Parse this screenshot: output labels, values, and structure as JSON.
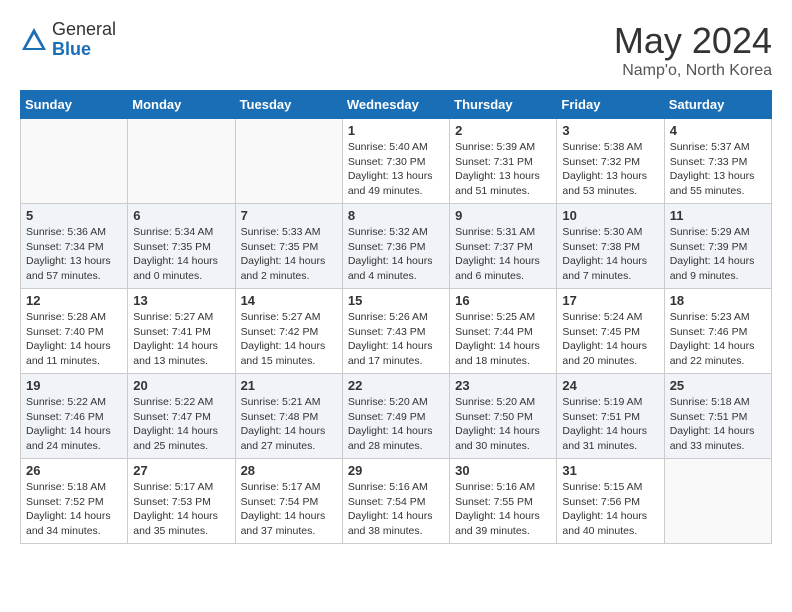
{
  "header": {
    "logo_general": "General",
    "logo_blue": "Blue",
    "month_title": "May 2024",
    "location": "Namp'o, North Korea"
  },
  "days_of_week": [
    "Sunday",
    "Monday",
    "Tuesday",
    "Wednesday",
    "Thursday",
    "Friday",
    "Saturday"
  ],
  "weeks": [
    {
      "days": [
        {
          "number": "",
          "info": ""
        },
        {
          "number": "",
          "info": ""
        },
        {
          "number": "",
          "info": ""
        },
        {
          "number": "1",
          "info": "Sunrise: 5:40 AM\nSunset: 7:30 PM\nDaylight: 13 hours\nand 49 minutes."
        },
        {
          "number": "2",
          "info": "Sunrise: 5:39 AM\nSunset: 7:31 PM\nDaylight: 13 hours\nand 51 minutes."
        },
        {
          "number": "3",
          "info": "Sunrise: 5:38 AM\nSunset: 7:32 PM\nDaylight: 13 hours\nand 53 minutes."
        },
        {
          "number": "4",
          "info": "Sunrise: 5:37 AM\nSunset: 7:33 PM\nDaylight: 13 hours\nand 55 minutes."
        }
      ]
    },
    {
      "days": [
        {
          "number": "5",
          "info": "Sunrise: 5:36 AM\nSunset: 7:34 PM\nDaylight: 13 hours\nand 57 minutes."
        },
        {
          "number": "6",
          "info": "Sunrise: 5:34 AM\nSunset: 7:35 PM\nDaylight: 14 hours\nand 0 minutes."
        },
        {
          "number": "7",
          "info": "Sunrise: 5:33 AM\nSunset: 7:35 PM\nDaylight: 14 hours\nand 2 minutes."
        },
        {
          "number": "8",
          "info": "Sunrise: 5:32 AM\nSunset: 7:36 PM\nDaylight: 14 hours\nand 4 minutes."
        },
        {
          "number": "9",
          "info": "Sunrise: 5:31 AM\nSunset: 7:37 PM\nDaylight: 14 hours\nand 6 minutes."
        },
        {
          "number": "10",
          "info": "Sunrise: 5:30 AM\nSunset: 7:38 PM\nDaylight: 14 hours\nand 7 minutes."
        },
        {
          "number": "11",
          "info": "Sunrise: 5:29 AM\nSunset: 7:39 PM\nDaylight: 14 hours\nand 9 minutes."
        }
      ]
    },
    {
      "days": [
        {
          "number": "12",
          "info": "Sunrise: 5:28 AM\nSunset: 7:40 PM\nDaylight: 14 hours\nand 11 minutes."
        },
        {
          "number": "13",
          "info": "Sunrise: 5:27 AM\nSunset: 7:41 PM\nDaylight: 14 hours\nand 13 minutes."
        },
        {
          "number": "14",
          "info": "Sunrise: 5:27 AM\nSunset: 7:42 PM\nDaylight: 14 hours\nand 15 minutes."
        },
        {
          "number": "15",
          "info": "Sunrise: 5:26 AM\nSunset: 7:43 PM\nDaylight: 14 hours\nand 17 minutes."
        },
        {
          "number": "16",
          "info": "Sunrise: 5:25 AM\nSunset: 7:44 PM\nDaylight: 14 hours\nand 18 minutes."
        },
        {
          "number": "17",
          "info": "Sunrise: 5:24 AM\nSunset: 7:45 PM\nDaylight: 14 hours\nand 20 minutes."
        },
        {
          "number": "18",
          "info": "Sunrise: 5:23 AM\nSunset: 7:46 PM\nDaylight: 14 hours\nand 22 minutes."
        }
      ]
    },
    {
      "days": [
        {
          "number": "19",
          "info": "Sunrise: 5:22 AM\nSunset: 7:46 PM\nDaylight: 14 hours\nand 24 minutes."
        },
        {
          "number": "20",
          "info": "Sunrise: 5:22 AM\nSunset: 7:47 PM\nDaylight: 14 hours\nand 25 minutes."
        },
        {
          "number": "21",
          "info": "Sunrise: 5:21 AM\nSunset: 7:48 PM\nDaylight: 14 hours\nand 27 minutes."
        },
        {
          "number": "22",
          "info": "Sunrise: 5:20 AM\nSunset: 7:49 PM\nDaylight: 14 hours\nand 28 minutes."
        },
        {
          "number": "23",
          "info": "Sunrise: 5:20 AM\nSunset: 7:50 PM\nDaylight: 14 hours\nand 30 minutes."
        },
        {
          "number": "24",
          "info": "Sunrise: 5:19 AM\nSunset: 7:51 PM\nDaylight: 14 hours\nand 31 minutes."
        },
        {
          "number": "25",
          "info": "Sunrise: 5:18 AM\nSunset: 7:51 PM\nDaylight: 14 hours\nand 33 minutes."
        }
      ]
    },
    {
      "days": [
        {
          "number": "26",
          "info": "Sunrise: 5:18 AM\nSunset: 7:52 PM\nDaylight: 14 hours\nand 34 minutes."
        },
        {
          "number": "27",
          "info": "Sunrise: 5:17 AM\nSunset: 7:53 PM\nDaylight: 14 hours\nand 35 minutes."
        },
        {
          "number": "28",
          "info": "Sunrise: 5:17 AM\nSunset: 7:54 PM\nDaylight: 14 hours\nand 37 minutes."
        },
        {
          "number": "29",
          "info": "Sunrise: 5:16 AM\nSunset: 7:54 PM\nDaylight: 14 hours\nand 38 minutes."
        },
        {
          "number": "30",
          "info": "Sunrise: 5:16 AM\nSunset: 7:55 PM\nDaylight: 14 hours\nand 39 minutes."
        },
        {
          "number": "31",
          "info": "Sunrise: 5:15 AM\nSunset: 7:56 PM\nDaylight: 14 hours\nand 40 minutes."
        },
        {
          "number": "",
          "info": ""
        }
      ]
    }
  ]
}
